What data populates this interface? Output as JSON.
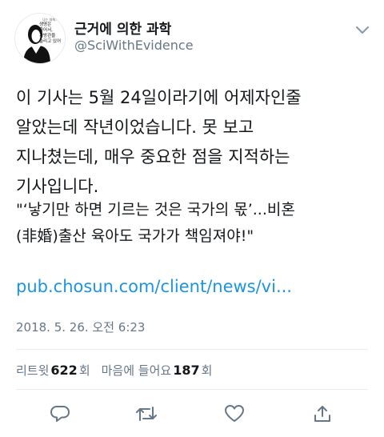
{
  "author": {
    "name": "근거에 의한 과학",
    "handle": "@SciWithEvidence",
    "avatar_text": {
      "small": "나는 대체..",
      "line1": "생명은",
      "line2": "줄어서,",
      "line3": "가방관을",
      "line4": "늘리고 있어"
    }
  },
  "tweet": {
    "text": "이 기사는 5월 24일이라기에 어제자인줄\n알았는데 작년이었습니다. 못 보고\n지나쳤는데, 매우 중요한 점을 지적하는\n기사입니다.",
    "quote": "\"‘낳기만 하면 기르는 것은 국가의 몫’...비혼\n(非婚)출산 육아도 국가가 책임져야!\"",
    "link": "pub.chosun.com/client/news/vi...",
    "timestamp": "2018. 5. 26. 오전 6:23"
  },
  "stats": {
    "retweet_label": "리트윗",
    "retweet_count": "622",
    "retweet_unit": "회",
    "like_label": "마음에 들어요",
    "like_count": "187",
    "like_unit": "회"
  },
  "icons": {
    "caret": "chevron-down-icon",
    "reply": "reply-icon",
    "retweet": "retweet-icon",
    "like": "heart-icon",
    "share": "share-icon"
  },
  "colors": {
    "link": "#1b95e0",
    "muted": "#657786",
    "text": "#14171a",
    "divider": "#e6ecf0"
  }
}
